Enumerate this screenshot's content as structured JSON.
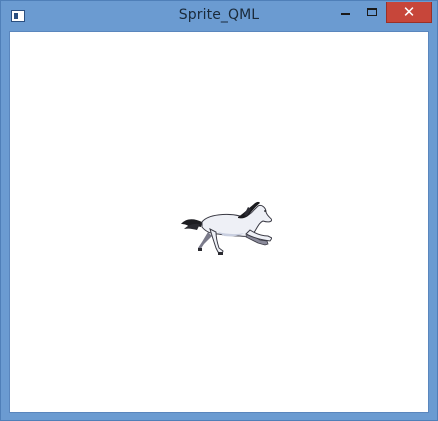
{
  "window": {
    "title": "Sprite_QML",
    "app_icon": "window-app-icon",
    "controls": {
      "minimize_icon": "minimize-icon",
      "maximize_icon": "maximize-icon",
      "close_icon": "close-icon",
      "close_glyph": "✕"
    },
    "colors": {
      "frame": "#6b9bd1",
      "close": "#c7463a",
      "client": "#ffffff"
    }
  },
  "content": {
    "sprite": "running-horse-sprite"
  }
}
